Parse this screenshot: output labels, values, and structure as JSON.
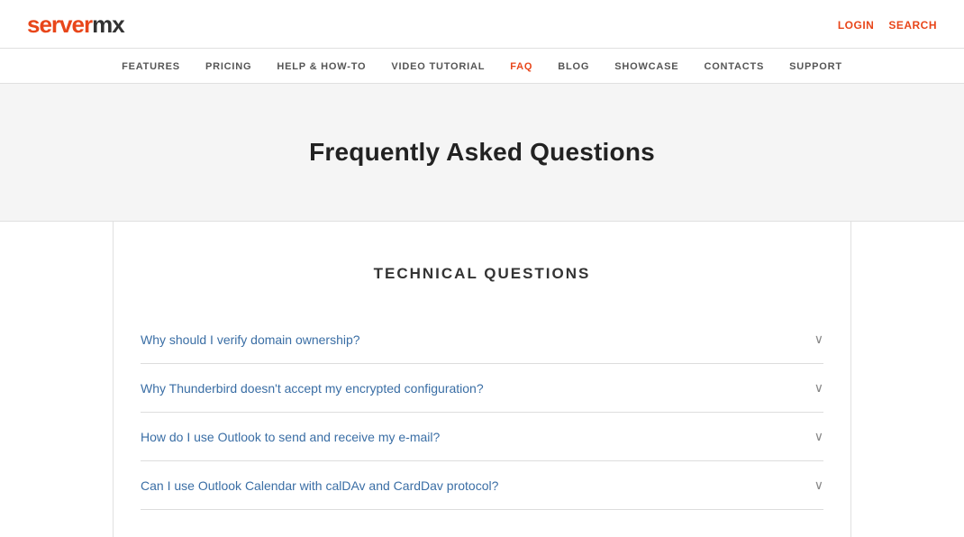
{
  "logo": {
    "text_orange": "server",
    "text_dark": "mx"
  },
  "header": {
    "login_label": "LOGIN",
    "search_label": "SEARCH"
  },
  "nav": {
    "items": [
      {
        "label": "FEATURES",
        "active": false
      },
      {
        "label": "PRICING",
        "active": false
      },
      {
        "label": "HELP & HOW-TO",
        "active": false
      },
      {
        "label": "VIDEO TUTORIAL",
        "active": false
      },
      {
        "label": "FAQ",
        "active": true
      },
      {
        "label": "BLOG",
        "active": false
      },
      {
        "label": "SHOWCASE",
        "active": false
      },
      {
        "label": "CONTACTS",
        "active": false
      },
      {
        "label": "SUPPORT",
        "active": false
      }
    ]
  },
  "hero": {
    "title": "Frequently Asked Questions"
  },
  "main": {
    "section_title": "TECHNICAL QUESTIONS",
    "faq_items": [
      {
        "question": "Why should I verify domain ownership?"
      },
      {
        "question": "Why Thunderbird doesn't accept my encrypted configuration?"
      },
      {
        "question": "How do I use Outlook to send and receive my e-mail?"
      },
      {
        "question": "Can I use Outlook Calendar with calDAv and CardDav protocol?"
      }
    ]
  }
}
